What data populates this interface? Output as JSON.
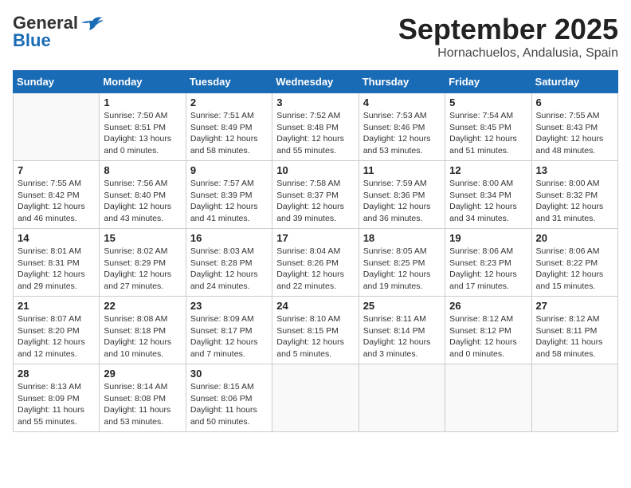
{
  "header": {
    "logo_line1": "General",
    "logo_line2": "Blue",
    "month_title": "September 2025",
    "location": "Hornachuelos, Andalusia, Spain"
  },
  "weekdays": [
    "Sunday",
    "Monday",
    "Tuesday",
    "Wednesday",
    "Thursday",
    "Friday",
    "Saturday"
  ],
  "weeks": [
    [
      {
        "day": "",
        "info": ""
      },
      {
        "day": "1",
        "info": "Sunrise: 7:50 AM\nSunset: 8:51 PM\nDaylight: 13 hours\nand 0 minutes."
      },
      {
        "day": "2",
        "info": "Sunrise: 7:51 AM\nSunset: 8:49 PM\nDaylight: 12 hours\nand 58 minutes."
      },
      {
        "day": "3",
        "info": "Sunrise: 7:52 AM\nSunset: 8:48 PM\nDaylight: 12 hours\nand 55 minutes."
      },
      {
        "day": "4",
        "info": "Sunrise: 7:53 AM\nSunset: 8:46 PM\nDaylight: 12 hours\nand 53 minutes."
      },
      {
        "day": "5",
        "info": "Sunrise: 7:54 AM\nSunset: 8:45 PM\nDaylight: 12 hours\nand 51 minutes."
      },
      {
        "day": "6",
        "info": "Sunrise: 7:55 AM\nSunset: 8:43 PM\nDaylight: 12 hours\nand 48 minutes."
      }
    ],
    [
      {
        "day": "7",
        "info": "Sunrise: 7:55 AM\nSunset: 8:42 PM\nDaylight: 12 hours\nand 46 minutes."
      },
      {
        "day": "8",
        "info": "Sunrise: 7:56 AM\nSunset: 8:40 PM\nDaylight: 12 hours\nand 43 minutes."
      },
      {
        "day": "9",
        "info": "Sunrise: 7:57 AM\nSunset: 8:39 PM\nDaylight: 12 hours\nand 41 minutes."
      },
      {
        "day": "10",
        "info": "Sunrise: 7:58 AM\nSunset: 8:37 PM\nDaylight: 12 hours\nand 39 minutes."
      },
      {
        "day": "11",
        "info": "Sunrise: 7:59 AM\nSunset: 8:36 PM\nDaylight: 12 hours\nand 36 minutes."
      },
      {
        "day": "12",
        "info": "Sunrise: 8:00 AM\nSunset: 8:34 PM\nDaylight: 12 hours\nand 34 minutes."
      },
      {
        "day": "13",
        "info": "Sunrise: 8:00 AM\nSunset: 8:32 PM\nDaylight: 12 hours\nand 31 minutes."
      }
    ],
    [
      {
        "day": "14",
        "info": "Sunrise: 8:01 AM\nSunset: 8:31 PM\nDaylight: 12 hours\nand 29 minutes."
      },
      {
        "day": "15",
        "info": "Sunrise: 8:02 AM\nSunset: 8:29 PM\nDaylight: 12 hours\nand 27 minutes."
      },
      {
        "day": "16",
        "info": "Sunrise: 8:03 AM\nSunset: 8:28 PM\nDaylight: 12 hours\nand 24 minutes."
      },
      {
        "day": "17",
        "info": "Sunrise: 8:04 AM\nSunset: 8:26 PM\nDaylight: 12 hours\nand 22 minutes."
      },
      {
        "day": "18",
        "info": "Sunrise: 8:05 AM\nSunset: 8:25 PM\nDaylight: 12 hours\nand 19 minutes."
      },
      {
        "day": "19",
        "info": "Sunrise: 8:06 AM\nSunset: 8:23 PM\nDaylight: 12 hours\nand 17 minutes."
      },
      {
        "day": "20",
        "info": "Sunrise: 8:06 AM\nSunset: 8:22 PM\nDaylight: 12 hours\nand 15 minutes."
      }
    ],
    [
      {
        "day": "21",
        "info": "Sunrise: 8:07 AM\nSunset: 8:20 PM\nDaylight: 12 hours\nand 12 minutes."
      },
      {
        "day": "22",
        "info": "Sunrise: 8:08 AM\nSunset: 8:18 PM\nDaylight: 12 hours\nand 10 minutes."
      },
      {
        "day": "23",
        "info": "Sunrise: 8:09 AM\nSunset: 8:17 PM\nDaylight: 12 hours\nand 7 minutes."
      },
      {
        "day": "24",
        "info": "Sunrise: 8:10 AM\nSunset: 8:15 PM\nDaylight: 12 hours\nand 5 minutes."
      },
      {
        "day": "25",
        "info": "Sunrise: 8:11 AM\nSunset: 8:14 PM\nDaylight: 12 hours\nand 3 minutes."
      },
      {
        "day": "26",
        "info": "Sunrise: 8:12 AM\nSunset: 8:12 PM\nDaylight: 12 hours\nand 0 minutes."
      },
      {
        "day": "27",
        "info": "Sunrise: 8:12 AM\nSunset: 8:11 PM\nDaylight: 11 hours\nand 58 minutes."
      }
    ],
    [
      {
        "day": "28",
        "info": "Sunrise: 8:13 AM\nSunset: 8:09 PM\nDaylight: 11 hours\nand 55 minutes."
      },
      {
        "day": "29",
        "info": "Sunrise: 8:14 AM\nSunset: 8:08 PM\nDaylight: 11 hours\nand 53 minutes."
      },
      {
        "day": "30",
        "info": "Sunrise: 8:15 AM\nSunset: 8:06 PM\nDaylight: 11 hours\nand 50 minutes."
      },
      {
        "day": "",
        "info": ""
      },
      {
        "day": "",
        "info": ""
      },
      {
        "day": "",
        "info": ""
      },
      {
        "day": "",
        "info": ""
      }
    ]
  ]
}
